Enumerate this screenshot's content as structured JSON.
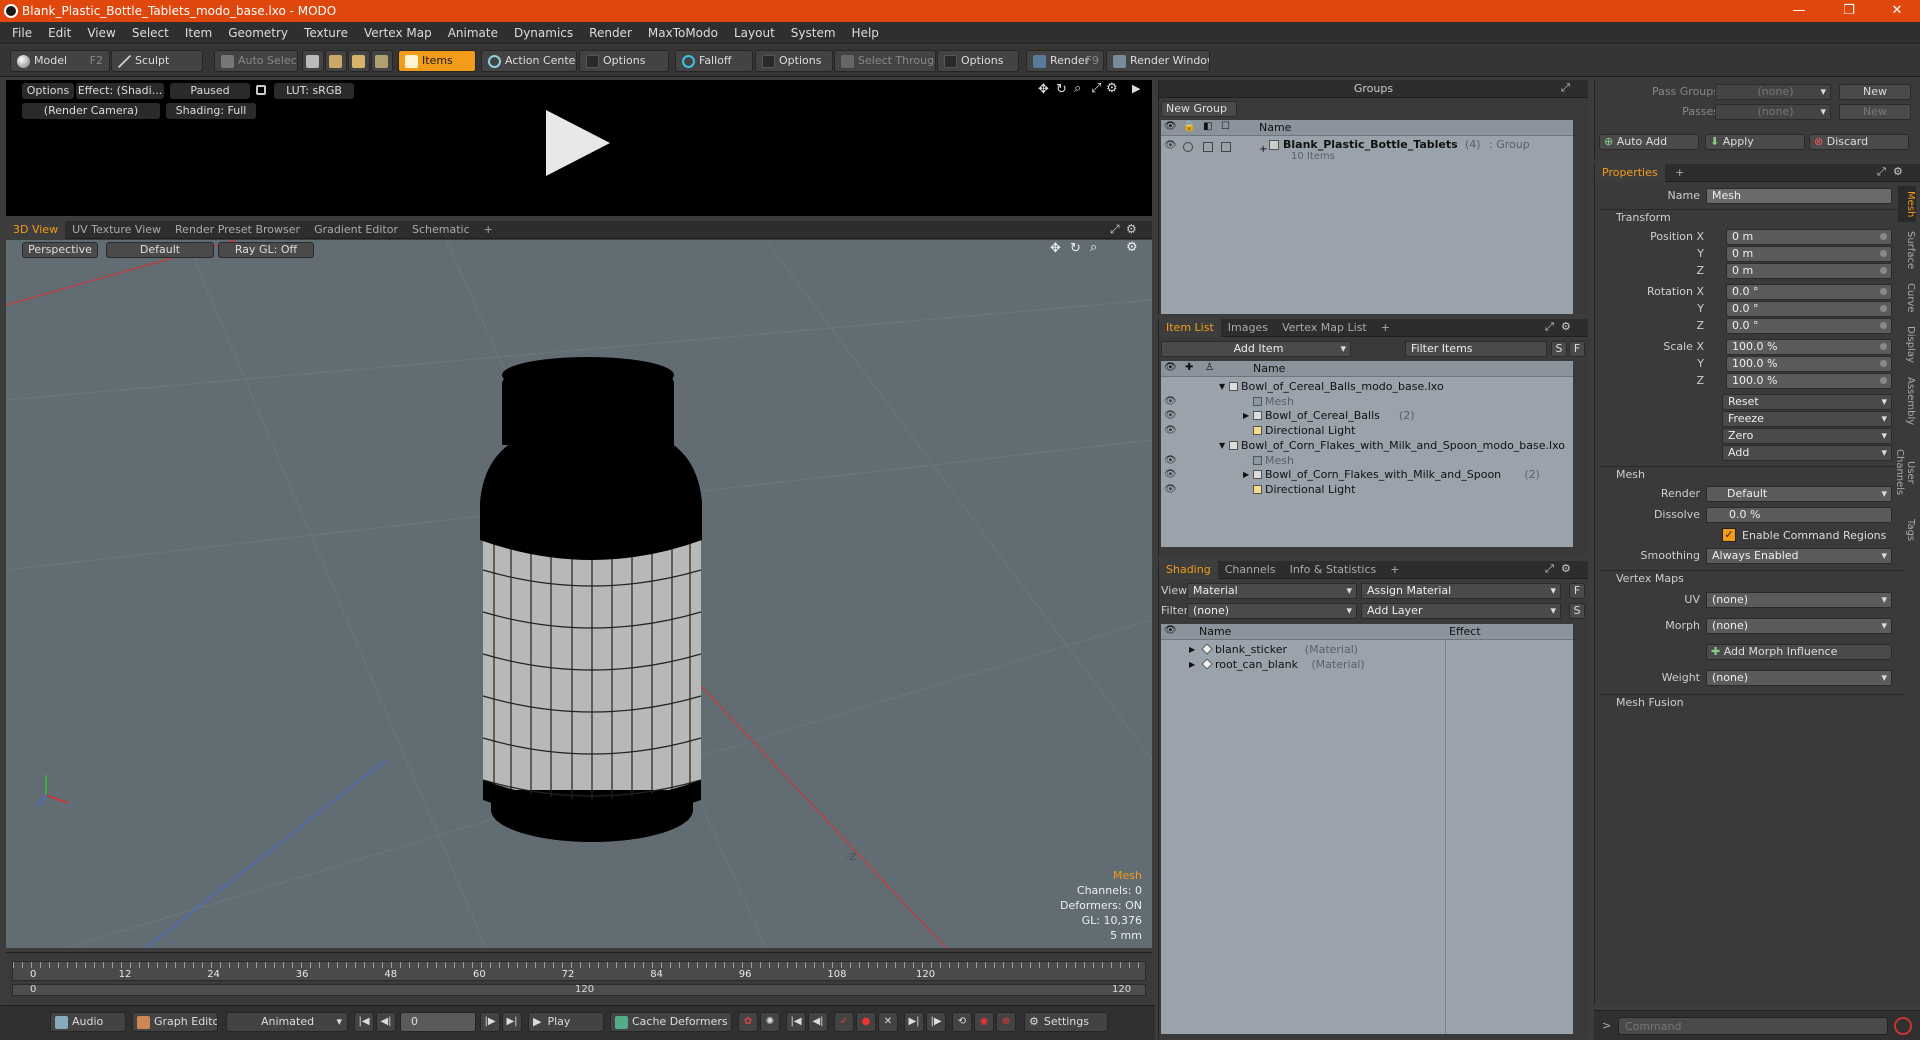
{
  "window": {
    "title": "Blank_Plastic_Bottle_Tablets_modo_base.lxo - MODO",
    "minimize": "—",
    "maximize": "❐",
    "close": "✕"
  },
  "menu": [
    "File",
    "Edit",
    "View",
    "Select",
    "Item",
    "Geometry",
    "Texture",
    "Vertex Map",
    "Animate",
    "Dynamics",
    "Render",
    "MaxToModo",
    "Layout",
    "System",
    "Help"
  ],
  "toolbar": {
    "model": "Model",
    "model_key": "F2",
    "sculpt": "Sculpt",
    "auto_select": "Auto Select",
    "items": "Items",
    "action_center": "Action Center",
    "options1": "Options",
    "falloff": "Falloff",
    "options2": "Options",
    "select_through": "Select Through",
    "options3": "Options",
    "render": "Render",
    "render_key": "F9",
    "render_window": "Render Window"
  },
  "preview": {
    "options": "Options",
    "effect": "Effect: (Shadi...",
    "paused": "Paused",
    "lut": "LUT: sRGB",
    "camera": "(Render Camera)",
    "shading": "Shading: Full"
  },
  "viewport": {
    "tabs": [
      "3D View",
      "UV Texture View",
      "Render Preset Browser",
      "Gradient Editor",
      "Schematic",
      "+"
    ],
    "perspective": "Perspective",
    "default": "Default",
    "raygl": "Ray GL: Off",
    "axis_label": "-Z",
    "info": {
      "mesh": "Mesh",
      "channels": "Channels: 0",
      "deformers": "Deformers: ON",
      "gl": "GL: 10,376",
      "size": "5 mm"
    }
  },
  "timeline": {
    "ticks": [
      "0",
      "12",
      "24",
      "36",
      "48",
      "60",
      "72",
      "84",
      "96",
      "108",
      "120"
    ],
    "sub_ticks": [
      "0",
      "120",
      "120"
    ]
  },
  "bottom": {
    "audio": "Audio",
    "graph_editor": "Graph Editor",
    "animated": "Animated",
    "frame": "0",
    "play": "Play",
    "cache_deformers": "Cache Deformers",
    "settings": "Settings"
  },
  "groups": {
    "title": "Groups",
    "new_group": "New Group",
    "col_name": "Name",
    "group_name": "Blank_Plastic_Bottle_Tablets",
    "group_count": "(4)",
    "group_type": ": Group",
    "group_items": "10 Items"
  },
  "item_list": {
    "tabs": [
      "Item List",
      "Images",
      "Vertex Map List",
      "+"
    ],
    "add_item": "Add Item",
    "filter_items": "Filter Items",
    "s": "S",
    "f": "F",
    "col_name": "Name",
    "rows": [
      {
        "label": "Bowl_of_Cereal_Balls_modo_base.lxo",
        "suffix": "",
        "dim": false,
        "depth": 0
      },
      {
        "label": "Mesh",
        "suffix": "",
        "dim": true,
        "depth": 1
      },
      {
        "label": "Bowl_of_Cereal_Balls",
        "suffix": "(2)",
        "dim": false,
        "depth": 1
      },
      {
        "label": "Directional Light",
        "suffix": "",
        "dim": false,
        "depth": 1
      },
      {
        "label": "Bowl_of_Corn_Flakes_with_Milk_and_Spoon_modo_base.lxo",
        "suffix": "",
        "dim": false,
        "depth": 0
      },
      {
        "label": "Mesh",
        "suffix": "",
        "dim": true,
        "depth": 1
      },
      {
        "label": "Bowl_of_Corn_Flakes_with_Milk_and_Spoon",
        "suffix": "(2)",
        "dim": false,
        "depth": 1
      },
      {
        "label": "Directional Light",
        "suffix": "",
        "dim": false,
        "depth": 1
      }
    ]
  },
  "shading": {
    "tabs": [
      "Shading",
      "Channels",
      "Info & Statistics",
      "+"
    ],
    "view_label": "View",
    "view_value": "Material",
    "assign_material": "Assign Material",
    "filter_label": "Filter",
    "filter_value": "(none)",
    "add_layer": "Add Layer",
    "f": "F",
    "s": "S",
    "col_name": "Name",
    "col_effect": "Effect",
    "rows": [
      {
        "label": "blank_sticker",
        "type": "(Material)"
      },
      {
        "label": "root_can_blank",
        "type": "(Material)"
      }
    ]
  },
  "pass": {
    "pass_groups": "Pass Groups",
    "passes": "Passes",
    "none1": "(none)",
    "none2": "(none)",
    "new1": "New",
    "new2": "New",
    "auto_add": "Auto Add",
    "apply": "Apply",
    "discard": "Discard"
  },
  "properties": {
    "tab": "Properties",
    "plus": "+",
    "name_label": "Name",
    "name_value": "Mesh",
    "transform": "Transform",
    "pos_label": "Position X",
    "rot_label": "Rotation X",
    "scale_label": "Scale X",
    "y": "Y",
    "z": "Z",
    "pos": [
      "0 m",
      "0 m",
      "0 m"
    ],
    "rot": [
      "0.0 °",
      "0.0 °",
      "0.0 °"
    ],
    "scale": [
      "100.0 %",
      "100.0 %",
      "100.0 %"
    ],
    "reset": "Reset",
    "freeze": "Freeze",
    "zero": "Zero",
    "add": "Add",
    "mesh": "Mesh",
    "render_label": "Render",
    "render_value": "Default",
    "dissolve_label": "Dissolve",
    "dissolve_value": "0.0 %",
    "enable_cmd": "Enable Command Regions",
    "smoothing_label": "Smoothing",
    "smoothing_value": "Always Enabled",
    "vertex_maps": "Vertex Maps",
    "uv_label": "UV",
    "uv_value": "(none)",
    "morph_label": "Morph",
    "morph_value": "(none)",
    "add_morph": "Add Morph Influence",
    "weight_label": "Weight",
    "weight_value": "(none)",
    "mesh_fusion": "Mesh Fusion",
    "side_tabs": [
      "Mesh",
      "Surface",
      "Curve",
      "Display",
      "Assembly",
      "User Channels",
      "Tags"
    ]
  },
  "command": {
    "placeholder": "Command",
    "prompt": ">"
  },
  "colors": {
    "accent": "#f39c1a",
    "title": "#e0470d"
  }
}
